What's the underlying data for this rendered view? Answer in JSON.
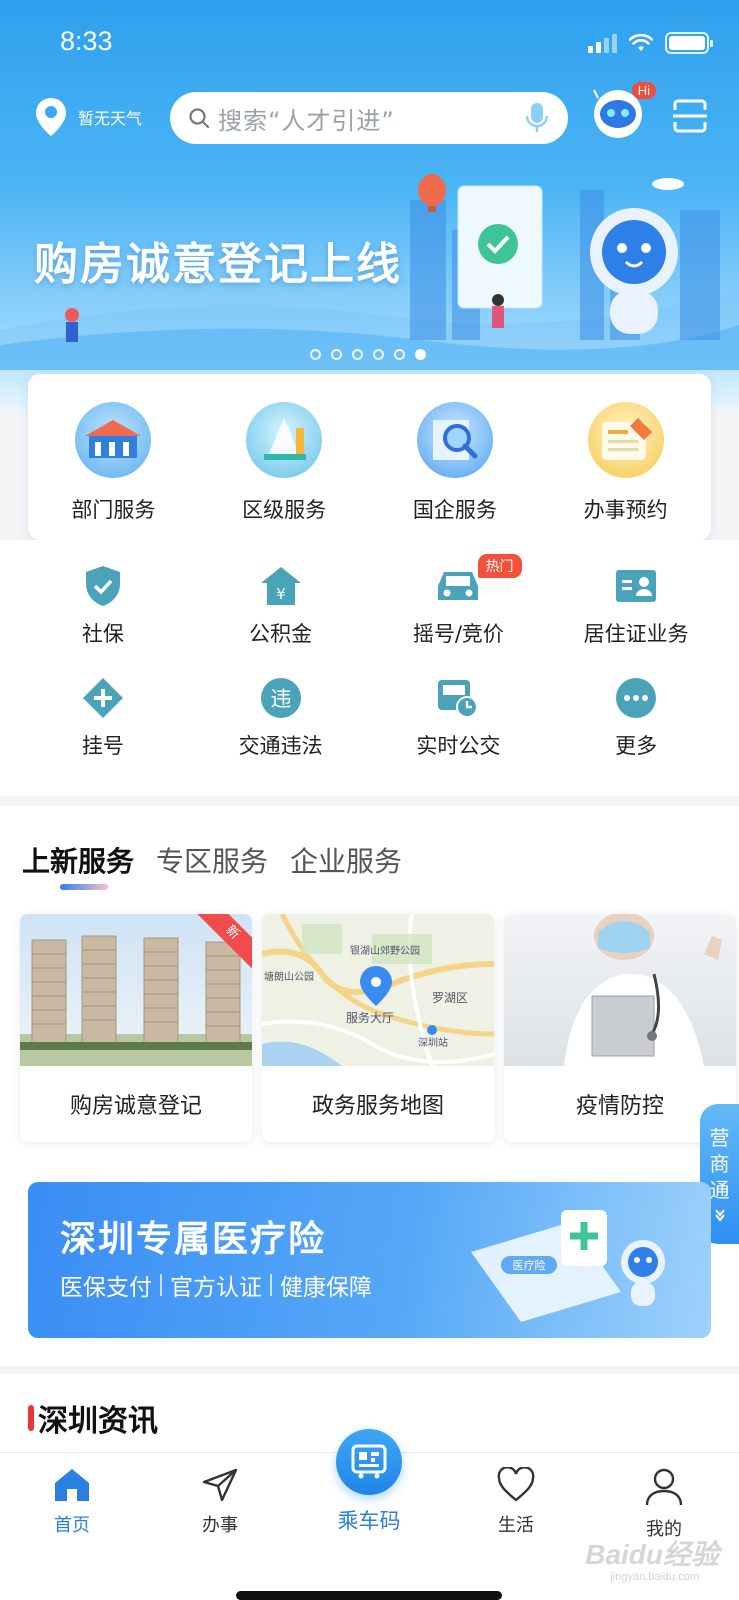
{
  "status_bar": {
    "time": "8:33"
  },
  "header": {
    "location_text": "暂无天气",
    "search_placeholder": "搜索“人才引进”",
    "robot_badge": "Hi"
  },
  "banner": {
    "title": "购房诚意登记上线",
    "pages": 6,
    "active_page": 6
  },
  "main_services": [
    {
      "label": "部门服务",
      "icon": "department-icon"
    },
    {
      "label": "区级服务",
      "icon": "district-icon"
    },
    {
      "label": "国企服务",
      "icon": "soe-icon"
    },
    {
      "label": "办事预约",
      "icon": "appointment-icon"
    }
  ],
  "services": [
    {
      "label": "社保",
      "icon": "shield-icon"
    },
    {
      "label": "公积金",
      "icon": "house-fund-icon"
    },
    {
      "label": "摇号/竞价",
      "icon": "car-icon",
      "badge": "热门"
    },
    {
      "label": "居住证业务",
      "icon": "id-card-icon"
    },
    {
      "label": "挂号",
      "icon": "plus-icon"
    },
    {
      "label": "交通违法",
      "icon": "violation-icon",
      "glyph": "违"
    },
    {
      "label": "实时公交",
      "icon": "bus-clock-icon"
    },
    {
      "label": "更多",
      "icon": "more-icon"
    }
  ],
  "tabs": [
    {
      "label": "上新服务",
      "active": true
    },
    {
      "label": "专区服务",
      "active": false
    },
    {
      "label": "企业服务",
      "active": false
    }
  ],
  "feature_cards": [
    {
      "label": "购房诚意登记",
      "tag": "新"
    },
    {
      "label": "政务服务地图",
      "map_labels": [
        "银湖山郊野公园",
        "塘朗山公园",
        "罗湖区",
        "服务大厅",
        "深圳站"
      ]
    },
    {
      "label": "疫情防控"
    }
  ],
  "side_tab": {
    "chars": [
      "营",
      "商",
      "通"
    ]
  },
  "insurance_banner": {
    "title": "深圳专属医疗险",
    "subtitle_parts": [
      "医保支付",
      "官方认证",
      "健康保障"
    ],
    "card_text": "医疗险"
  },
  "news": {
    "title": "深圳资讯"
  },
  "bottom_nav": {
    "items": [
      {
        "label": "首页",
        "active": true
      },
      {
        "label": "办事",
        "active": false
      },
      {
        "label": "乘车码",
        "active": false
      },
      {
        "label": "生活",
        "active": false
      },
      {
        "label": "我的",
        "active": false
      }
    ]
  },
  "watermark": {
    "text": "Baidu经验",
    "sub": "jingyan.baidu.com"
  },
  "colors": {
    "primary": "#2b7fe0",
    "hero": "#3aa8f2",
    "icon_teal": "#4aa3b8",
    "hot": "#f2523c"
  }
}
